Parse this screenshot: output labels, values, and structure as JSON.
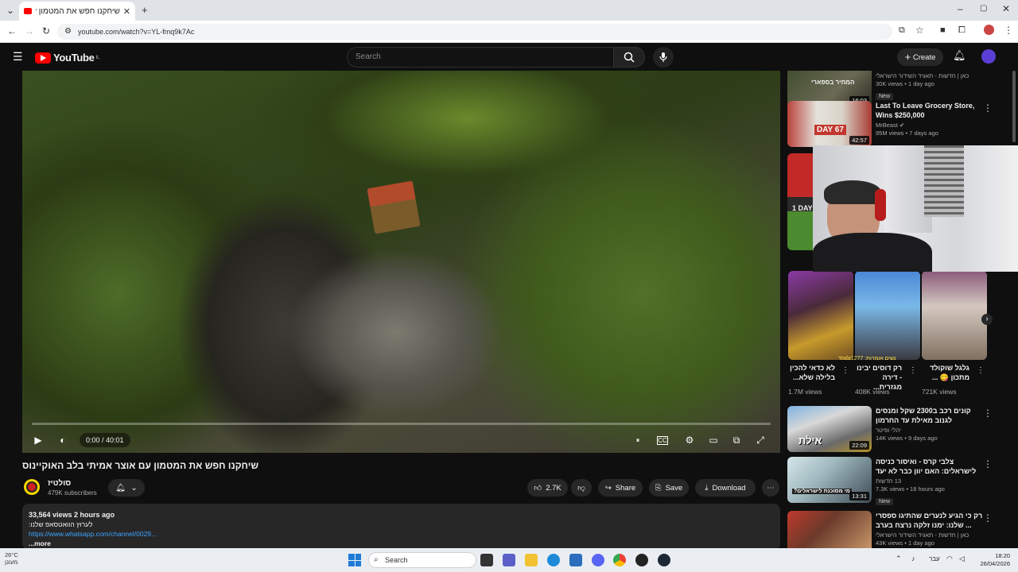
{
  "browser": {
    "tab_title": "שיחקנו חפש את המטמון עם אוצר אמיתי בלב האוקיינוס - YouTube",
    "url": "youtube.com/watch?v=YL-fmq9k7Ac"
  },
  "header": {
    "logo_text": "YouTube",
    "region": "IL",
    "search_placeholder": "Search",
    "create_label": "Create"
  },
  "player": {
    "time": "0:00 / 40:01",
    "progress": 0
  },
  "video": {
    "title": "שיחקנו חפש את המטמון עם אוצר אמיתי בלב האוקיינוס",
    "channel": "סולטיז",
    "subscribers": "479K subscribers",
    "likes": "2.7K",
    "share_label": "Share",
    "save_label": "Save",
    "download_label": "Download",
    "views_age": "33,564 views  2 hours ago",
    "desc_line1": "לערוץ הוואטסאפ שלנו:",
    "desc_link": "https://www.whatsapp.com/channel/0029...",
    "desc_more": "...more"
  },
  "sidebar": {
    "top_partial": {
      "channel": "כאן | חדשות - תאגיד השידור הישראלי",
      "views": "30K views • 1 day ago",
      "badge": "New",
      "duration": "16:03",
      "thumb_text": "המחיר בספארי"
    },
    "recs": [
      {
        "title": "Last To Leave Grocery Store, Wins $250,000",
        "channel": "MrBeast",
        "views": "95M views • 7 days ago",
        "duration": "42:57",
        "thumb_text": "DAY 67"
      },
      {
        "title": "קונים רכב ב2300 שקל ומנסים לגנוב מאילת עד החרמון",
        "channel": "יהלי ופיטר",
        "views": "14K views • 9 days ago",
        "duration": "22:09",
        "thumb_text": "אילת"
      },
      {
        "title": "צלבי קרס - ואיסור כניסה לישראלים: האם יוון כבר לא יעד בטוח?",
        "channel": "13 חדשות",
        "views": "7.3K views • 18 hours ago",
        "badge": "New",
        "duration": "13:31",
        "thumb_text": "מי מסוכנת לישראלים?"
      },
      {
        "title": "רק כי הגיע לנערים שהתיגו ספסרי ... שלנו: ימנו זלקה נרצח בערב יום",
        "channel": "כאן | חדשות - תאגיד השידור הישראלי",
        "views": "43K views • 1 day ago",
        "duration": "",
        "thumb_text": ""
      }
    ],
    "shorts": [
      {
        "title": "לא כדאי להכין בלילה שלא...",
        "views": "1.7M views"
      },
      {
        "title": "רק דוסים יבינו - דירה מגזרית...",
        "views": "408K views"
      },
      {
        "title": "גלגל שוקולד מתכון 😋 ...",
        "views": "721K views"
      }
    ],
    "shorts_overlay": "נשים אומרות: Yoda1277",
    "partial_label": "1 DAY"
  },
  "taskbar": {
    "temp": "26°C",
    "weather": "מעונן",
    "search": "Search",
    "lang": "עבר",
    "time": "18:20",
    "date": "26/04/2026"
  },
  "colors": {
    "yt_red": "#ff0000",
    "bg": "#0f0f0f",
    "link": "#3ea6ff"
  }
}
